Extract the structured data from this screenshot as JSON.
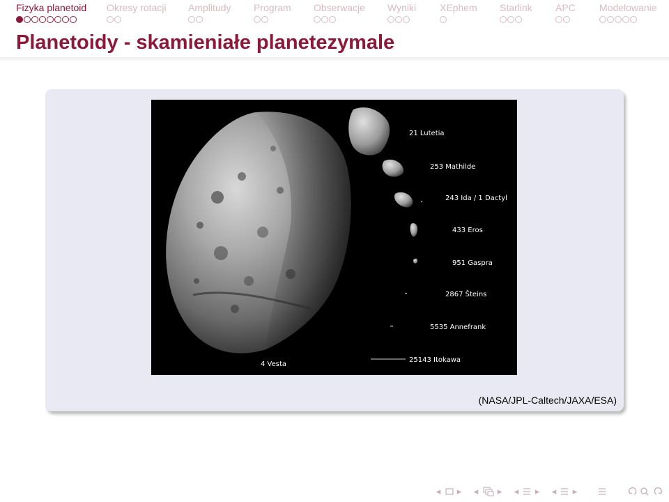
{
  "nav": {
    "sections": [
      {
        "label": "Fizyka planetoid",
        "dots": 8,
        "current": 1,
        "active": true
      },
      {
        "label": "Okresy rotacji",
        "dots": 2,
        "active": false
      },
      {
        "label": "Amplitudy",
        "dots": 2,
        "active": false
      },
      {
        "label": "Program",
        "dots": 2,
        "active": false
      },
      {
        "label": "Obserwacje",
        "dots": 3,
        "active": false
      },
      {
        "label": "Wyniki",
        "dots": 3,
        "active": false
      },
      {
        "label": "XEphem",
        "dots": 1,
        "active": false
      },
      {
        "label": "Starlink",
        "dots": 3,
        "active": false
      },
      {
        "label": "APC",
        "dots": 2,
        "active": false
      },
      {
        "label": "Modelowanie",
        "dots": 5,
        "active": false
      }
    ]
  },
  "frame": {
    "title": "Planetoidy - skamieniałe planetezymale",
    "credit": "(NASA/JPL-Caltech/JAXA/ESA)"
  },
  "figure": {
    "labels": {
      "vesta": "4 Vesta",
      "lutetia": "21 Lutetia",
      "mathilde": "253 Mathilde",
      "ida": "243 Ida / 1 Dactyl",
      "eros": "433 Eros",
      "gaspra": "951 Gaspra",
      "steins": "2867 Šteins",
      "annefrank": "5535 Annefrank",
      "itokawa": "25143 Itokawa"
    }
  },
  "bottom_nav": {
    "icons": [
      "nav-prev-frame-icon",
      "nav-frame-icon",
      "nav-next-frame-icon",
      "nav-prev-subsection-icon",
      "nav-subsection-icon",
      "nav-next-subsection-icon",
      "nav-prev-section-icon",
      "nav-section-icon",
      "nav-next-section-icon",
      "nav-prev-slide-icon",
      "nav-slide-icon",
      "nav-next-slide-icon",
      "nav-appendix-icon",
      "nav-search-icon",
      "nav-back-icon",
      "nav-forward-icon"
    ]
  },
  "colors": {
    "accent": "#8b1a3a",
    "inactive": "#d8bcc3",
    "block_bg": "#e9e9f3",
    "photo_bg": "#000000"
  }
}
